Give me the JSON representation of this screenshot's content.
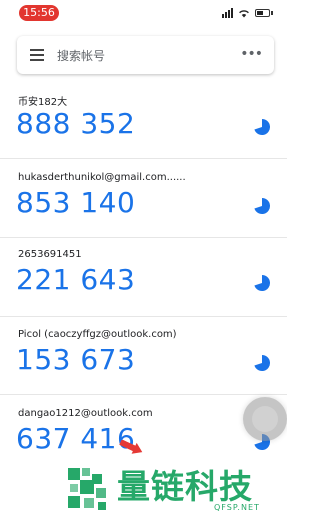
{
  "status_bar": {
    "time": "15:56",
    "icons": [
      "signal-icon",
      "wifi-icon",
      "battery-icon"
    ]
  },
  "search": {
    "placeholder": "搜索帐号",
    "menu_icon": "menu-icon",
    "more_icon": "more-vert-icon",
    "more_label": "•••"
  },
  "accounts": [
    {
      "name": "币安182大",
      "code": "888 352"
    },
    {
      "name": "hukasderthunikol@gmail.com......",
      "code": "853 140"
    },
    {
      "name": "2653691451",
      "code": "221 643"
    },
    {
      "name": "Picol (caoczyffgz@outlook.com)",
      "code": "153 673"
    },
    {
      "name": "dangao1212@outlook.com",
      "code": "637 416"
    }
  ],
  "colors": {
    "accent": "#1a73e8",
    "status_time_bg": "#e2362f",
    "watermark": "#26a869"
  },
  "watermark": {
    "title": "量链科技",
    "subtitle": "QFSP.NET"
  }
}
